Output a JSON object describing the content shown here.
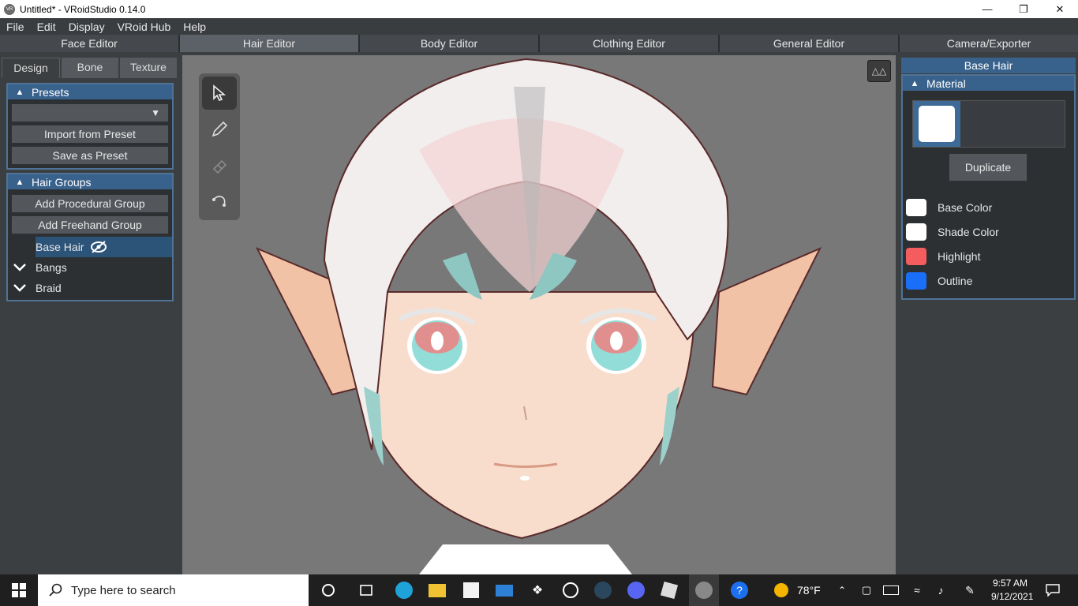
{
  "window": {
    "title": "Untitled* - VRoidStudio 0.14.0",
    "icon": "vroid-icon",
    "minimize_glyph": "—",
    "restore_glyph": "❐",
    "close_glyph": "✕"
  },
  "menu": {
    "items": [
      "File",
      "Edit",
      "Display",
      "VRoid Hub",
      "Help"
    ]
  },
  "editor_tabs": [
    "Face Editor",
    "Hair Editor",
    "Body Editor",
    "Clothing Editor",
    "General Editor",
    "Camera/Exporter"
  ],
  "left": {
    "subtabs": [
      "Design",
      "Bone",
      "Texture"
    ],
    "presets": {
      "header": "Presets",
      "dropdown_value": "",
      "import_label": "Import from Preset",
      "save_label": "Save as Preset"
    },
    "hair_groups": {
      "header": "Hair Groups",
      "add_procedural": "Add Procedural Group",
      "add_freehand": "Add Freehand Group",
      "items": [
        {
          "label": "Base Hair",
          "selected": true
        },
        {
          "label": "Bangs",
          "selected": false
        },
        {
          "label": "Braid",
          "selected": false
        }
      ]
    }
  },
  "right": {
    "title": "Base Hair",
    "material_header": "Material",
    "duplicate_label": "Duplicate",
    "colors": [
      {
        "label": "Base Color",
        "hex": "#ffffff"
      },
      {
        "label": "Shade Color",
        "hex": "#ffffff"
      },
      {
        "label": "Highlight",
        "hex": "#f35d5d"
      },
      {
        "label": "Outline",
        "hex": "#1a6ef7"
      }
    ]
  },
  "taskbar": {
    "search_placeholder": "Type here to search",
    "weather": "78°F",
    "time": "9:57 AM",
    "date": "9/12/2021"
  }
}
